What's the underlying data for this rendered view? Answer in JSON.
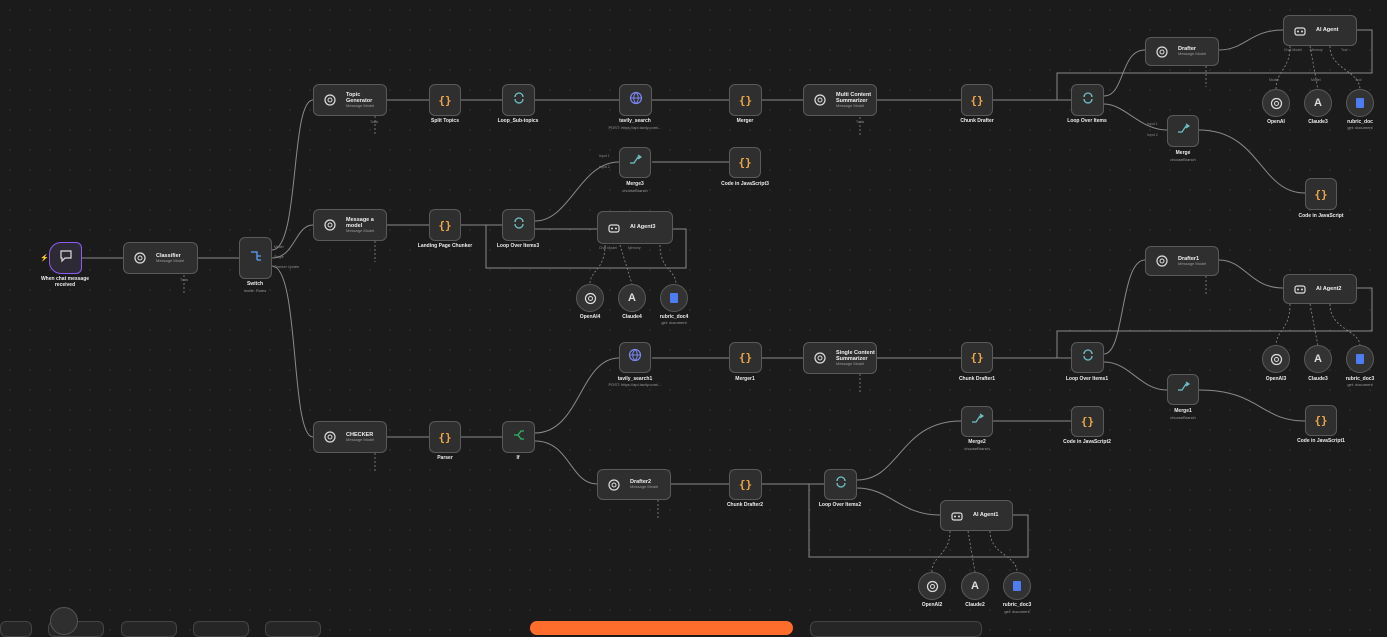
{
  "nodes": {
    "trigger": {
      "title": "When chat message received"
    },
    "classifier": {
      "title": "Classifier",
      "sub": "Message Model"
    },
    "switch": {
      "title": "Switch",
      "sub": "mode: Rules"
    },
    "topic_generator": {
      "title": "Topic Generator",
      "sub": "Message Model"
    },
    "split_topics": {
      "title": "Split Topics"
    },
    "loop_sub_topics": {
      "title": "Loop_Sub-topics"
    },
    "tavily_search": {
      "title": "tavily_search",
      "sub": "POST: https://api.tavily.com/..."
    },
    "merger": {
      "title": "Merger"
    },
    "multi_content": {
      "title": "Multi Content Summarizer",
      "sub": "Message Model"
    },
    "chunk_drafter": {
      "title": "Chunk Drafter"
    },
    "loop_over_items": {
      "title": "Loop Over Items"
    },
    "drafter": {
      "title": "Drafter",
      "sub": "Message Model"
    },
    "ai_agent": {
      "title": "AI Agent"
    },
    "openai": {
      "title": "OpenAI"
    },
    "claude3": {
      "title": "Claude3"
    },
    "rubric_doc": {
      "title": "rubric_doc",
      "sub": "get: document"
    },
    "merge": {
      "title": "Merge",
      "sub": "chooseBranch"
    },
    "code_js": {
      "title": "Code in JavaScript"
    },
    "message_a_model": {
      "title": "Message a model",
      "sub": "Message Model"
    },
    "landing_page_chunker": {
      "title": "Landing Page Chunker"
    },
    "loop_over_items3": {
      "title": "Loop Over Items3"
    },
    "merge3": {
      "title": "Merge3",
      "sub": "chooseBranch"
    },
    "code_js3": {
      "title": "Code in JavaScript3"
    },
    "ai_agent3": {
      "title": "AI Agent3"
    },
    "openai4": {
      "title": "OpenAI4"
    },
    "claude4": {
      "title": "Claude4"
    },
    "rubric_doc4": {
      "title": "rubric_doc4",
      "sub": "get: document"
    },
    "drafter1": {
      "title": "Drafter1",
      "sub": "Message Model"
    },
    "ai_agent2": {
      "title": "AI Agent2"
    },
    "openai3": {
      "title": "OpenAI3"
    },
    "claude3b": {
      "title": "Claude3"
    },
    "rubric_doc3": {
      "title": "rubric_doc3",
      "sub": "get: document"
    },
    "tavily_search1": {
      "title": "tavily_search1",
      "sub": "POST: https://api.tavily.com/..."
    },
    "merger1": {
      "title": "Merger1"
    },
    "single_content": {
      "title": "Single Content Summarizer",
      "sub": "Message Model"
    },
    "chunk_drafter1": {
      "title": "Chunk Drafter1"
    },
    "loop_over_items1": {
      "title": "Loop Over Items1"
    },
    "merge1": {
      "title": "Merge1",
      "sub": "chooseBranch"
    },
    "code_js1": {
      "title": "Code in JavaScript1"
    },
    "checker": {
      "title": "CHECKER",
      "sub": "Message Model"
    },
    "parser": {
      "title": "Parser"
    },
    "if": {
      "title": "If"
    },
    "merge2": {
      "title": "Merge2",
      "sub": "chooseBranch"
    },
    "code_js2": {
      "title": "Code in JavaScript2"
    },
    "drafter2": {
      "title": "Drafter2",
      "sub": "Message Model"
    },
    "chunk_drafter2": {
      "title": "Chunk Drafter2"
    },
    "loop_over_items2": {
      "title": "Loop Over Items2"
    },
    "ai_agent1": {
      "title": "AI Agent1"
    },
    "openai2": {
      "title": "OpenAI2"
    },
    "claude2": {
      "title": "Claude2"
    },
    "rubric_doc3b": {
      "title": "rubric_doc3",
      "sub": "get: document"
    }
  },
  "labels": {
    "tools": "Tools",
    "model": "Model",
    "tool": "Tool",
    "chat_model": "Chat Model",
    "memory": "Memory",
    "input1": "Input 1",
    "input2": "Input 2",
    "done": "done",
    "loop": "loop",
    "items": "1 item",
    "true": "true",
    "false": "false",
    "branch_model": "Model",
    "branch_single": "Single",
    "branch_checker": "Checker Update"
  },
  "colors": {
    "accent": "#ff6d2d",
    "trigger_border": "#8b5cf6",
    "code": "#f0a848",
    "loop": "#6fc3c9",
    "http": "#7b86f0",
    "merge": "#6fc3c9",
    "if": "#2fb866",
    "doc": "#4f7cf0"
  }
}
